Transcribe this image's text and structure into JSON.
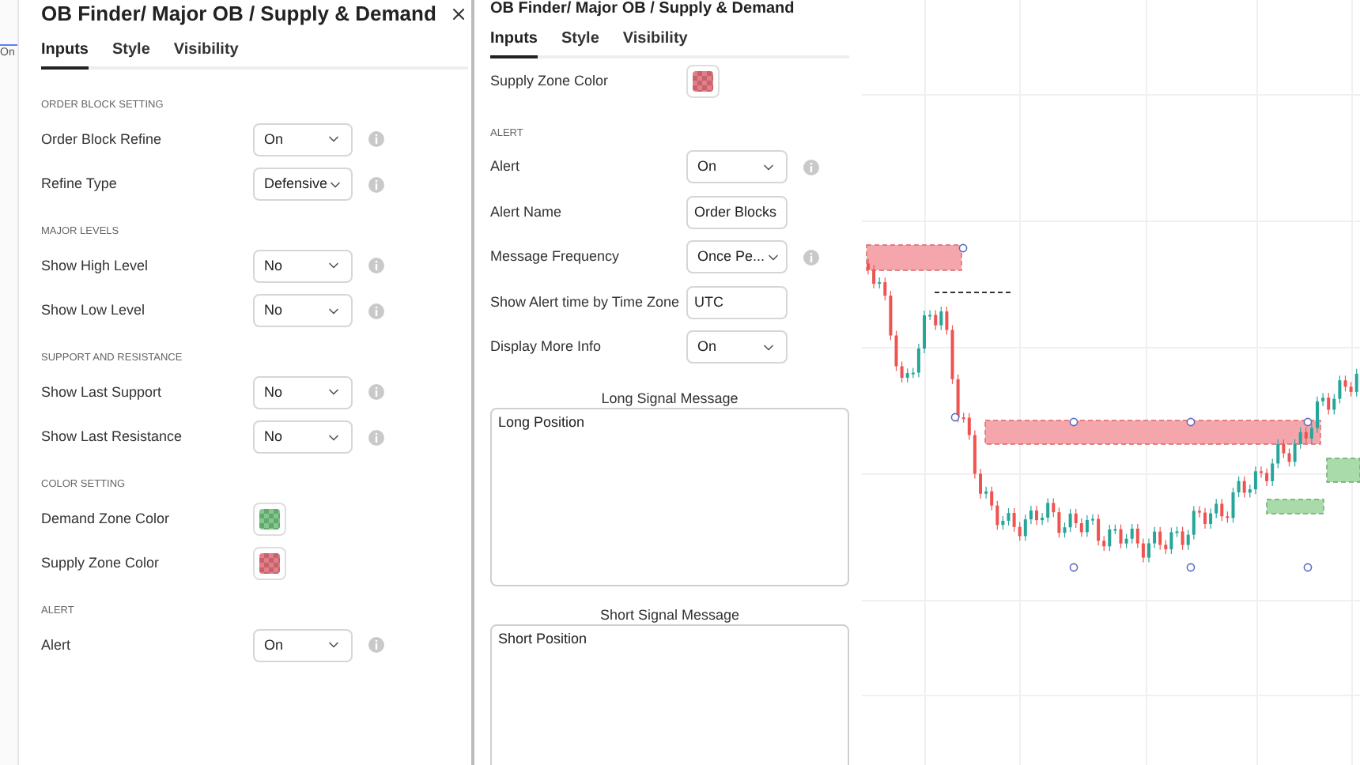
{
  "left_strip": {
    "field_value": "On"
  },
  "settings_panel": {
    "title": "OB Finder/ Major OB / Supply & Demand",
    "tabs": [
      {
        "label": "Inputs",
        "selected": true
      },
      {
        "label": "Style",
        "selected": false
      },
      {
        "label": "Visibility",
        "selected": false
      }
    ],
    "sections": [
      {
        "heading": "ORDER BLOCK SETTING",
        "rows": [
          {
            "kind": "select",
            "label": "Order Block Refine",
            "value": "On",
            "info": true
          },
          {
            "kind": "select",
            "label": "Refine Type",
            "value": "Defensive",
            "info": true
          }
        ]
      },
      {
        "heading": "MAJOR LEVELS",
        "rows": [
          {
            "kind": "select",
            "label": "Show High Level",
            "value": "No",
            "info": true
          },
          {
            "kind": "select",
            "label": "Show Low Level",
            "value": "No",
            "info": true
          }
        ]
      },
      {
        "heading": "SUPPORT AND RESISTANCE",
        "rows": [
          {
            "kind": "select",
            "label": "Show Last Support",
            "value": "No",
            "info": true
          },
          {
            "kind": "select",
            "label": "Show Last Resistance",
            "value": "No",
            "info": true
          }
        ]
      },
      {
        "heading": "COLOR SETTING",
        "rows": [
          {
            "kind": "color",
            "label": "Demand Zone Color",
            "color": "#7fc98a",
            "info": false
          },
          {
            "kind": "color",
            "label": "Supply Zone Color",
            "color": "#e87b86",
            "info": false
          }
        ]
      },
      {
        "heading": "ALERT",
        "rows": [
          {
            "kind": "select",
            "label": "Alert",
            "value": "On",
            "info": true
          }
        ]
      }
    ]
  },
  "scrolled_panel": {
    "title": "OB Finder/ Major OB / Supply & Demand",
    "tabs": [
      {
        "label": "Inputs",
        "selected": true
      },
      {
        "label": "Style",
        "selected": false
      },
      {
        "label": "Visibility",
        "selected": false
      }
    ],
    "sections": [
      {
        "rows": [
          {
            "kind": "color",
            "label": "Supply Zone Color",
            "color": "#e87b86",
            "info": false
          }
        ]
      },
      {
        "heading": "ALERT",
        "rows": [
          {
            "kind": "select",
            "label": "Alert",
            "value": "On",
            "info": true
          },
          {
            "kind": "text",
            "label": "Alert Name",
            "value": "Order Blocks",
            "info": false
          },
          {
            "kind": "select",
            "label": "Message Frequency",
            "value": "Once Pe...",
            "info": true
          },
          {
            "kind": "text",
            "label": "Show Alert time by Time Zone",
            "value": "UTC",
            "info": false
          },
          {
            "kind": "select",
            "label": "Display More Info",
            "value": "On",
            "info": false
          }
        ]
      }
    ],
    "messages": [
      {
        "label": "Long Signal Message",
        "value": "Long Position"
      },
      {
        "label": "Short Signal Message",
        "value": "Short Position"
      }
    ]
  }
}
